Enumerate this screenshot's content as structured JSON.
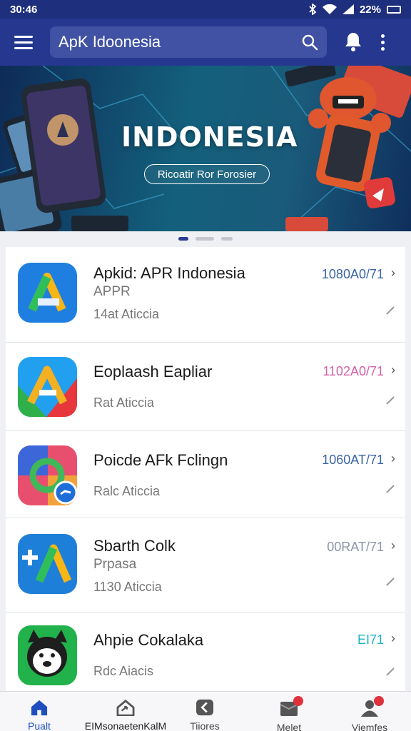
{
  "status_bar": {
    "time": "30:46",
    "battery": "22%"
  },
  "header": {
    "search_value": "ApK Idoonesia"
  },
  "banner": {
    "title": "INDONESIA",
    "button": "Ricoatir Ror Forosier",
    "slide_index": 1,
    "slide_count": 3
  },
  "apps": [
    {
      "name": "Apkid: APR Indonesia",
      "sub": "APPR",
      "meta": "14at Aticcia",
      "code": "1080A0/71",
      "code_color": "#3a64a8"
    },
    {
      "name": "Eoplaash Eapliar",
      "sub": "",
      "meta": "Rat Aticcia",
      "code": "1102A0/71",
      "code_color": "#d561a8"
    },
    {
      "name": "Poicde AFk Fclingn",
      "sub": "",
      "meta": "Ralc Aticcia",
      "code": "1060AT/71",
      "code_color": "#3a64a8"
    },
    {
      "name": "Sbarth Colk",
      "sub": "Prpasa",
      "meta": "1130 Aticcia",
      "code": "00RAT/71",
      "code_color": "#8d96a6"
    },
    {
      "name": "Ahpie Cokalaka",
      "sub": "",
      "meta": "Rdc Aiacis",
      "code": "EI71",
      "code_color": "#1fb2c9"
    }
  ],
  "bottom_nav": [
    {
      "label": "Pualt",
      "active": true
    },
    {
      "label": "EIMsonaetenKalM",
      "active": false
    },
    {
      "label": "Tiiores",
      "active": false
    },
    {
      "label": "Melet",
      "active": false
    },
    {
      "label": "Viemfes",
      "active": false
    }
  ],
  "colors": {
    "app_bar": "#26378f",
    "status_bar": "#1e2f7d",
    "accent": "#1f4fbf",
    "badge": "#e0323c"
  }
}
